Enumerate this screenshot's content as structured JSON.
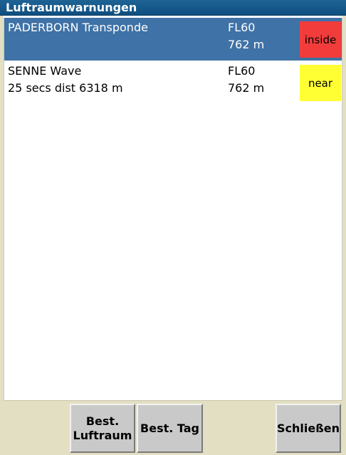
{
  "window": {
    "title": "Luftraumwarnungen"
  },
  "warnings": [
    {
      "name": "PADERBORN Transponde",
      "info": "",
      "flight_level": "FL60",
      "altitude": "762 m",
      "status": "inside",
      "status_color": "#f23c3c",
      "selected": true
    },
    {
      "name": "SENNE Wave",
      "info": "25 secs dist 6318 m",
      "flight_level": "FL60",
      "altitude": "762 m",
      "status": "near",
      "status_color": "#ffff33",
      "selected": false
    }
  ],
  "buttons": {
    "best_luftraum": "Best.\nLuftraum",
    "best_tag": "Best. Tag",
    "schliessen": "Schließen"
  },
  "colors": {
    "title_bar": "#1f6496",
    "selected_row": "#3f72a6",
    "footer": "#e3dfc3"
  }
}
